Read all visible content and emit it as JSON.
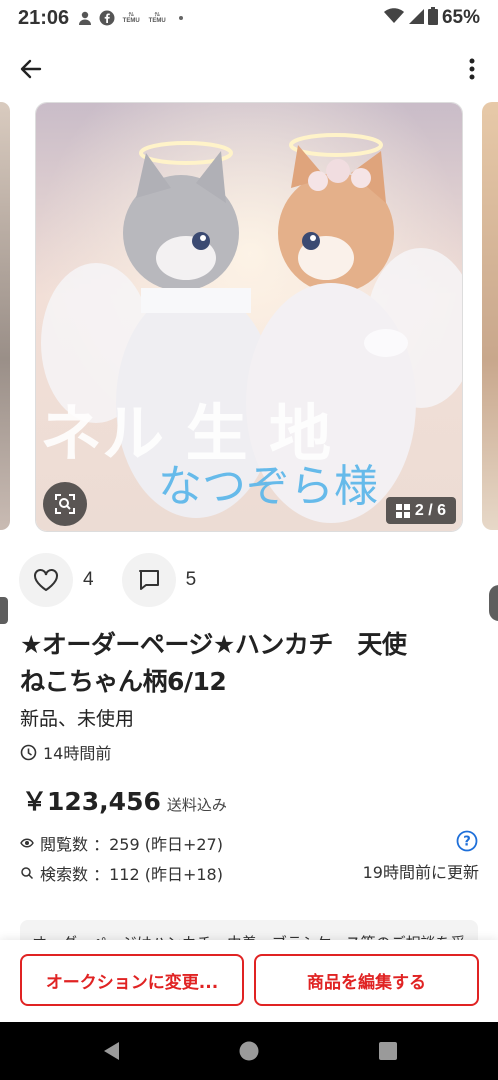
{
  "status_bar": {
    "time": "21:06",
    "temu_label": "TEMU",
    "battery": "65%"
  },
  "carousel": {
    "image_overlay_text_1": "ネル 生 地",
    "image_overlay_text_2": "なつぞら様",
    "counter": "2 / 6"
  },
  "reactions": {
    "likes": "4",
    "comments": "5"
  },
  "item": {
    "title_line1": "★オーダーページ★ハンカチ　天使",
    "title_line2": "ねこちゃん柄6/12",
    "condition": "新品、未使用",
    "posted": "14時間前",
    "price": "￥123,456",
    "shipping": "送料込み"
  },
  "stats": {
    "views": "閲覧数 ：259 (昨日+27)",
    "searches": "検索数 ：112 (昨日+18)",
    "updated": "19時間前に更新"
  },
  "description_peek": "オーダーページはハンカチ・巾着・ブラシケース等のご相談を受",
  "actions": {
    "auction": "オークションに変更...",
    "edit": "商品を編集する"
  },
  "colors": {
    "accent": "#e02323",
    "help": "#1e6fd9"
  }
}
